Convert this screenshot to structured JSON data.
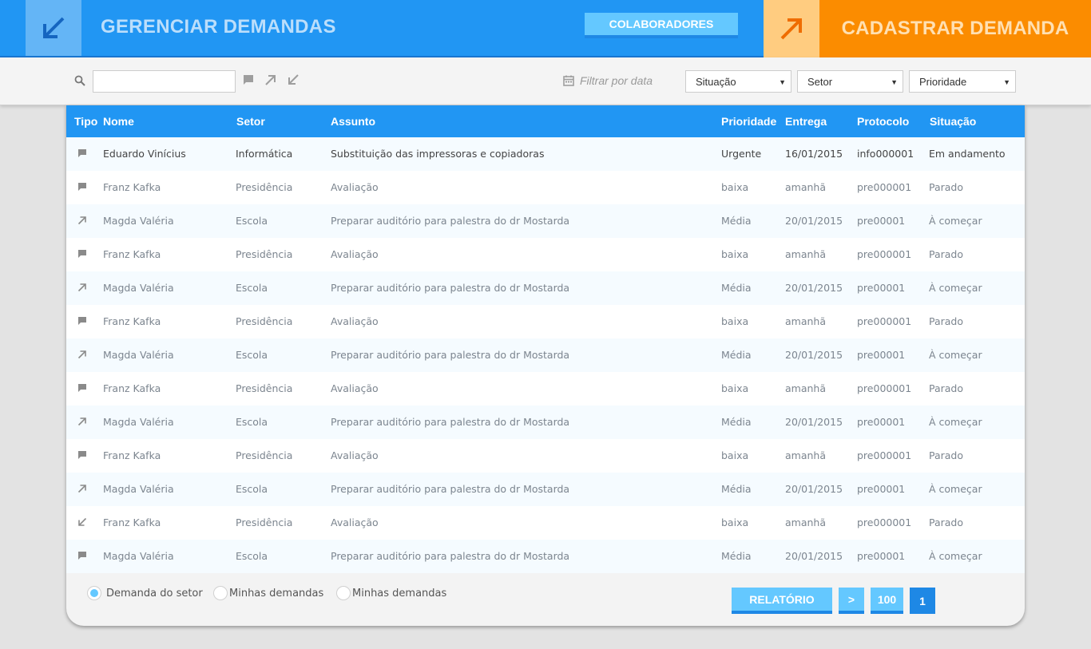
{
  "header": {
    "title": "GERENCIAR DEMANDAS",
    "collaborators_label": "COLABORADORES",
    "register_label": "CADASTRAR DEMANDA"
  },
  "filters": {
    "search_value": "",
    "date_label": "Filtrar por data",
    "situacao": "Situação",
    "setor": "Setor",
    "prioridade": "Prioridade"
  },
  "table": {
    "columns": [
      "Tipo",
      "Nome",
      "Setor",
      "Assunto",
      "Prioridade",
      "Entrega",
      "Protocolo",
      "Situação"
    ],
    "rows": [
      {
        "tipo_icon": "chat-icon",
        "nome": "Eduardo Vinícius",
        "setor": "Informática",
        "assunto": "Substituição das impressoras e copiadoras",
        "prioridade": "Urgente",
        "entrega": "16/01/2015",
        "protocolo": "info000001",
        "situacao": "Em andamento"
      },
      {
        "tipo_icon": "chat-icon",
        "nome": "Franz Kafka",
        "setor": "Presidência",
        "assunto": "Avaliação",
        "prioridade": "baixa",
        "entrega": "amanhã",
        "protocolo": "pre000001",
        "situacao": "Parado"
      },
      {
        "tipo_icon": "arrow-up-right-icon",
        "nome": "Magda Valéria",
        "setor": "Escola",
        "assunto": "Preparar auditório para palestra do dr Mostarda",
        "prioridade": "Média",
        "entrega": "20/01/2015",
        "protocolo": "pre00001",
        "situacao": "À começar"
      },
      {
        "tipo_icon": "chat-icon",
        "nome": "Franz Kafka",
        "setor": "Presidência",
        "assunto": "Avaliação",
        "prioridade": "baixa",
        "entrega": "amanhã",
        "protocolo": "pre000001",
        "situacao": "Parado"
      },
      {
        "tipo_icon": "arrow-up-right-icon",
        "nome": "Magda Valéria",
        "setor": "Escola",
        "assunto": "Preparar auditório para palestra do dr Mostarda",
        "prioridade": "Média",
        "entrega": "20/01/2015",
        "protocolo": "pre00001",
        "situacao": "À começar"
      },
      {
        "tipo_icon": "chat-icon",
        "nome": "Franz Kafka",
        "setor": "Presidência",
        "assunto": "Avaliação",
        "prioridade": "baixa",
        "entrega": "amanhã",
        "protocolo": "pre000001",
        "situacao": "Parado"
      },
      {
        "tipo_icon": "arrow-up-right-icon",
        "nome": "Magda Valéria",
        "setor": "Escola",
        "assunto": "Preparar auditório para palestra do dr Mostarda",
        "prioridade": "Média",
        "entrega": "20/01/2015",
        "protocolo": "pre00001",
        "situacao": "À começar"
      },
      {
        "tipo_icon": "chat-icon",
        "nome": "Franz Kafka",
        "setor": "Presidência",
        "assunto": "Avaliação",
        "prioridade": "baixa",
        "entrega": "amanhã",
        "protocolo": "pre000001",
        "situacao": "Parado"
      },
      {
        "tipo_icon": "arrow-up-right-icon",
        "nome": "Magda Valéria",
        "setor": "Escola",
        "assunto": "Preparar auditório para palestra do dr Mostarda",
        "prioridade": "Média",
        "entrega": "20/01/2015",
        "protocolo": "pre00001",
        "situacao": "À começar"
      },
      {
        "tipo_icon": "chat-icon",
        "nome": "Franz Kafka",
        "setor": "Presidência",
        "assunto": "Avaliação",
        "prioridade": "baixa",
        "entrega": "amanhã",
        "protocolo": "pre000001",
        "situacao": "Parado"
      },
      {
        "tipo_icon": "arrow-up-right-icon",
        "nome": "Magda Valéria",
        "setor": "Escola",
        "assunto": "Preparar auditório para palestra do dr Mostarda",
        "prioridade": "Média",
        "entrega": "20/01/2015",
        "protocolo": "pre00001",
        "situacao": "À começar"
      },
      {
        "tipo_icon": "arrow-down-left-icon",
        "nome": "Franz Kafka",
        "setor": "Presidência",
        "assunto": "Avaliação",
        "prioridade": "baixa",
        "entrega": "amanhã",
        "protocolo": "pre000001",
        "situacao": "Parado"
      },
      {
        "tipo_icon": "chat-icon",
        "nome": "Magda Valéria",
        "setor": "Escola",
        "assunto": "Preparar auditório para palestra do dr Mostarda",
        "prioridade": "Média",
        "entrega": "20/01/2015",
        "protocolo": "pre00001",
        "situacao": "À começar"
      }
    ]
  },
  "footer": {
    "radios": [
      {
        "label": "Demanda do setor",
        "checked": true
      },
      {
        "label": "Minhas demandas",
        "checked": false
      },
      {
        "label": "Minhas demandas",
        "checked": false
      }
    ],
    "report_label": "RELATÓRIO",
    "next_label": ">",
    "page_size_label": "100",
    "current_page_label": "1"
  },
  "colors": {
    "header_blue": "#2196f3",
    "register_orange": "#fb8c00",
    "button_light_blue": "#64c8ff",
    "button_dark_blue": "#1e88e5"
  }
}
